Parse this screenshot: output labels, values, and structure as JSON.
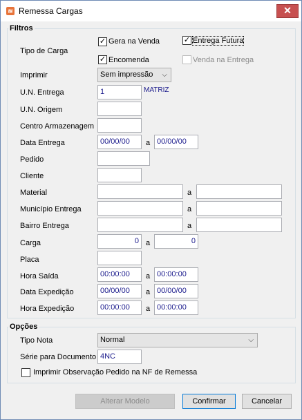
{
  "window": {
    "title": "Remessa Cargas",
    "close": "✕",
    "icon": "app-icon"
  },
  "filtros": {
    "title": "Filtros",
    "tipo_carga_label": "Tipo de Carga",
    "gera_na_venda": {
      "label": "Gera na Venda",
      "checked": true
    },
    "entrega_futura": {
      "label": "Entrega Futura",
      "checked": true
    },
    "encomenda": {
      "label": "Encomenda",
      "checked": true
    },
    "venda_na_entrega": {
      "label": "Venda na Entrega",
      "checked": false
    },
    "imprimir": {
      "label": "Imprimir",
      "value": "Sem impressão"
    },
    "un_entrega": {
      "label": "U.N. Entrega",
      "value": "1",
      "desc": "MATRIZ"
    },
    "un_origem": {
      "label": "U.N. Origem",
      "value": ""
    },
    "centro_armazenagem": {
      "label": "Centro Armazenagem",
      "value": ""
    },
    "data_entrega": {
      "label": "Data Entrega",
      "from": "00/00/00",
      "to": "00/00/00"
    },
    "pedido": {
      "label": "Pedido",
      "value": ""
    },
    "cliente": {
      "label": "Cliente",
      "value": ""
    },
    "material": {
      "label": "Material",
      "from": "",
      "to": ""
    },
    "municipio_entrega": {
      "label": "Município Entrega",
      "from": "",
      "to": ""
    },
    "bairro_entrega": {
      "label": "Bairro Entrega",
      "from": "",
      "to": ""
    },
    "carga": {
      "label": "Carga",
      "from": "0",
      "to": "0"
    },
    "placa": {
      "label": "Placa",
      "value": ""
    },
    "hora_saida": {
      "label": "Hora Saída",
      "from": "00:00:00",
      "to": "00:00:00"
    },
    "data_expedicao": {
      "label": "Data Expedição",
      "from": "00/00/00",
      "to": "00/00/00"
    },
    "hora_expedicao": {
      "label": "Hora Expedição",
      "from": "00:00:00",
      "to": "00:00:00"
    },
    "range_sep": "a"
  },
  "opcoes": {
    "title": "Opções",
    "tipo_nota": {
      "label": "Tipo Nota",
      "value": "Normal"
    },
    "serie_documento": {
      "label": "Série para Documento",
      "value": "4NC"
    },
    "imprimir_obs": {
      "label": "Imprimir Observação Pedido na NF de Remessa",
      "checked": false
    }
  },
  "buttons": {
    "alterar_modelo": "Alterar Modelo",
    "confirmar": "Confirmar",
    "cancelar": "Cancelar"
  }
}
